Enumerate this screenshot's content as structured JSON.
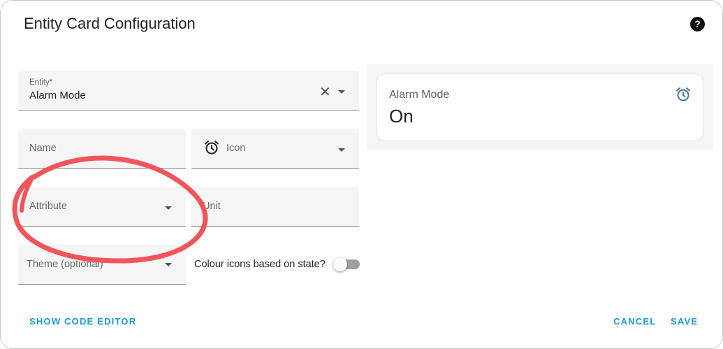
{
  "dialog": {
    "title": "Entity Card Configuration",
    "help_icon": "help-circle-icon",
    "help_glyph": "?"
  },
  "form": {
    "entity": {
      "label": "Entity*",
      "value": "Alarm Mode"
    },
    "name": {
      "label": "Name"
    },
    "icon": {
      "label": "Icon",
      "icon": "alarm-clock-icon"
    },
    "attribute": {
      "label": "Attribute"
    },
    "unit": {
      "label": "Unit"
    },
    "theme": {
      "label": "Theme (optional)"
    },
    "colour_toggle": {
      "label": "Colour icons based on state?",
      "checked": false
    }
  },
  "preview": {
    "name": "Alarm Mode",
    "state": "On",
    "icon": "alarm-clock-icon"
  },
  "actions": {
    "show_code_editor": "SHOW CODE EDITOR",
    "cancel": "CANCEL",
    "save": "SAVE"
  },
  "colors": {
    "accent": "#1a9ad6",
    "annotation": "#f0555a",
    "preview_icon": "#44739e"
  }
}
